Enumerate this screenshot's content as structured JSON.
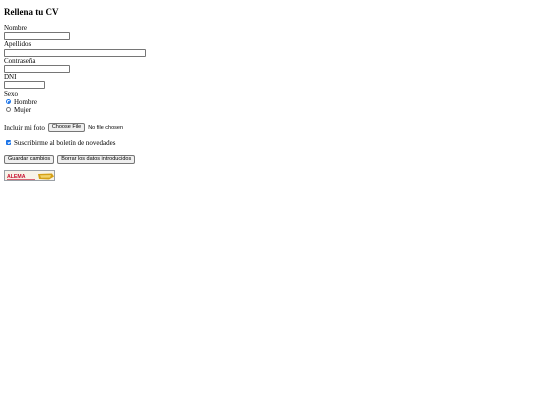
{
  "form": {
    "title": "Rellena tu CV",
    "fields": {
      "nombre_label": "Nombre",
      "apellidos_label": "Apellidos",
      "contrasena_label": "Contraseña",
      "dni_label": "DNI",
      "sexo_label": "Sexo"
    },
    "sexo_options": {
      "hombre": "Hombre",
      "mujer": "Mujer",
      "selected": "Hombre"
    },
    "foto": {
      "label": "Incluir mi foto",
      "button_label": "Choose File",
      "status": "No file chosen"
    },
    "newsletter": {
      "label": "Suscribirme al boletín de novedades",
      "checked": true
    },
    "buttons": {
      "save": "Guardar cambios",
      "reset": "Borrar los datos introducidos"
    },
    "logo": {
      "text": "ALEMA",
      "colors": {
        "text": "#c8102e",
        "accent": "#d4a017"
      }
    }
  }
}
